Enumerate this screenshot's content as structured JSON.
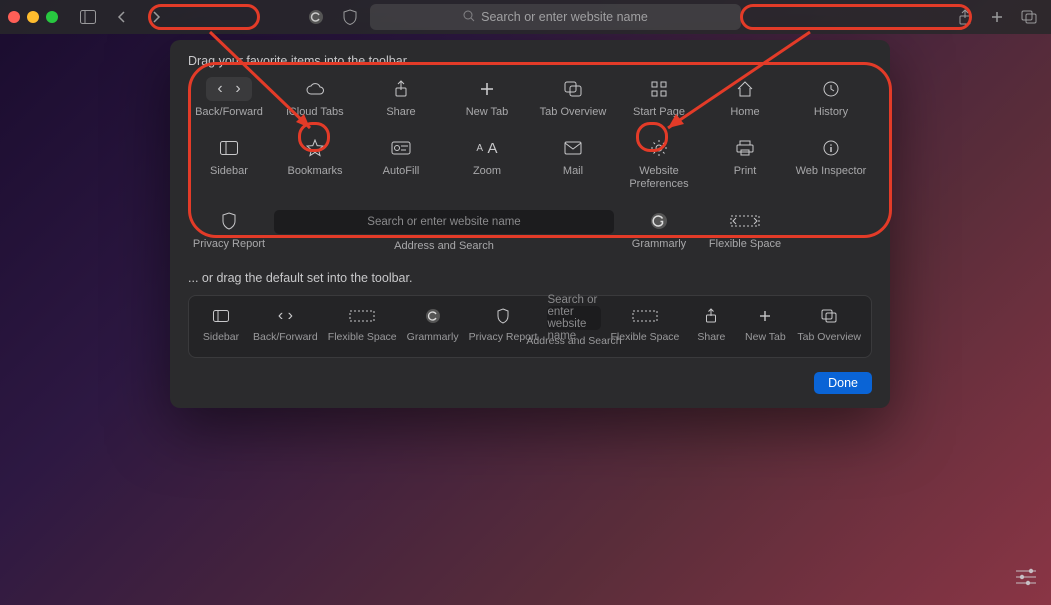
{
  "toolbar": {
    "search_placeholder": "Search or enter website name"
  },
  "panel": {
    "heading": "Drag your favorite items into the toolbar...",
    "items": {
      "back_forward": "Back/Forward",
      "icloud_tabs": "iCloud Tabs",
      "share": "Share",
      "new_tab": "New Tab",
      "tab_overview": "Tab Overview",
      "start_page": "Start Page",
      "home": "Home",
      "history": "History",
      "sidebar": "Sidebar",
      "bookmarks": "Bookmarks",
      "autofill": "AutoFill",
      "zoom": "Zoom",
      "mail": "Mail",
      "website_prefs": "Website\nPreferences",
      "print": "Print",
      "web_inspector": "Web Inspector",
      "privacy_report": "Privacy Report",
      "address_search": "Address and Search",
      "address_search_placeholder": "Search or enter website name",
      "grammarly": "Grammarly",
      "flexible_space": "Flexible Space"
    },
    "subheading": "... or drag the default set into the toolbar.",
    "defaults": {
      "sidebar": "Sidebar",
      "back_forward": "Back/Forward",
      "flexible_space": "Flexible Space",
      "grammarly": "Grammarly",
      "privacy_report": "Privacy Report",
      "address_search": "Address and Search",
      "address_search_placeholder": "Search or enter website name",
      "flexible_space2": "Flexible Space",
      "share": "Share",
      "new_tab": "New Tab",
      "tab_overview": "Tab Overview"
    },
    "done": "Done"
  }
}
